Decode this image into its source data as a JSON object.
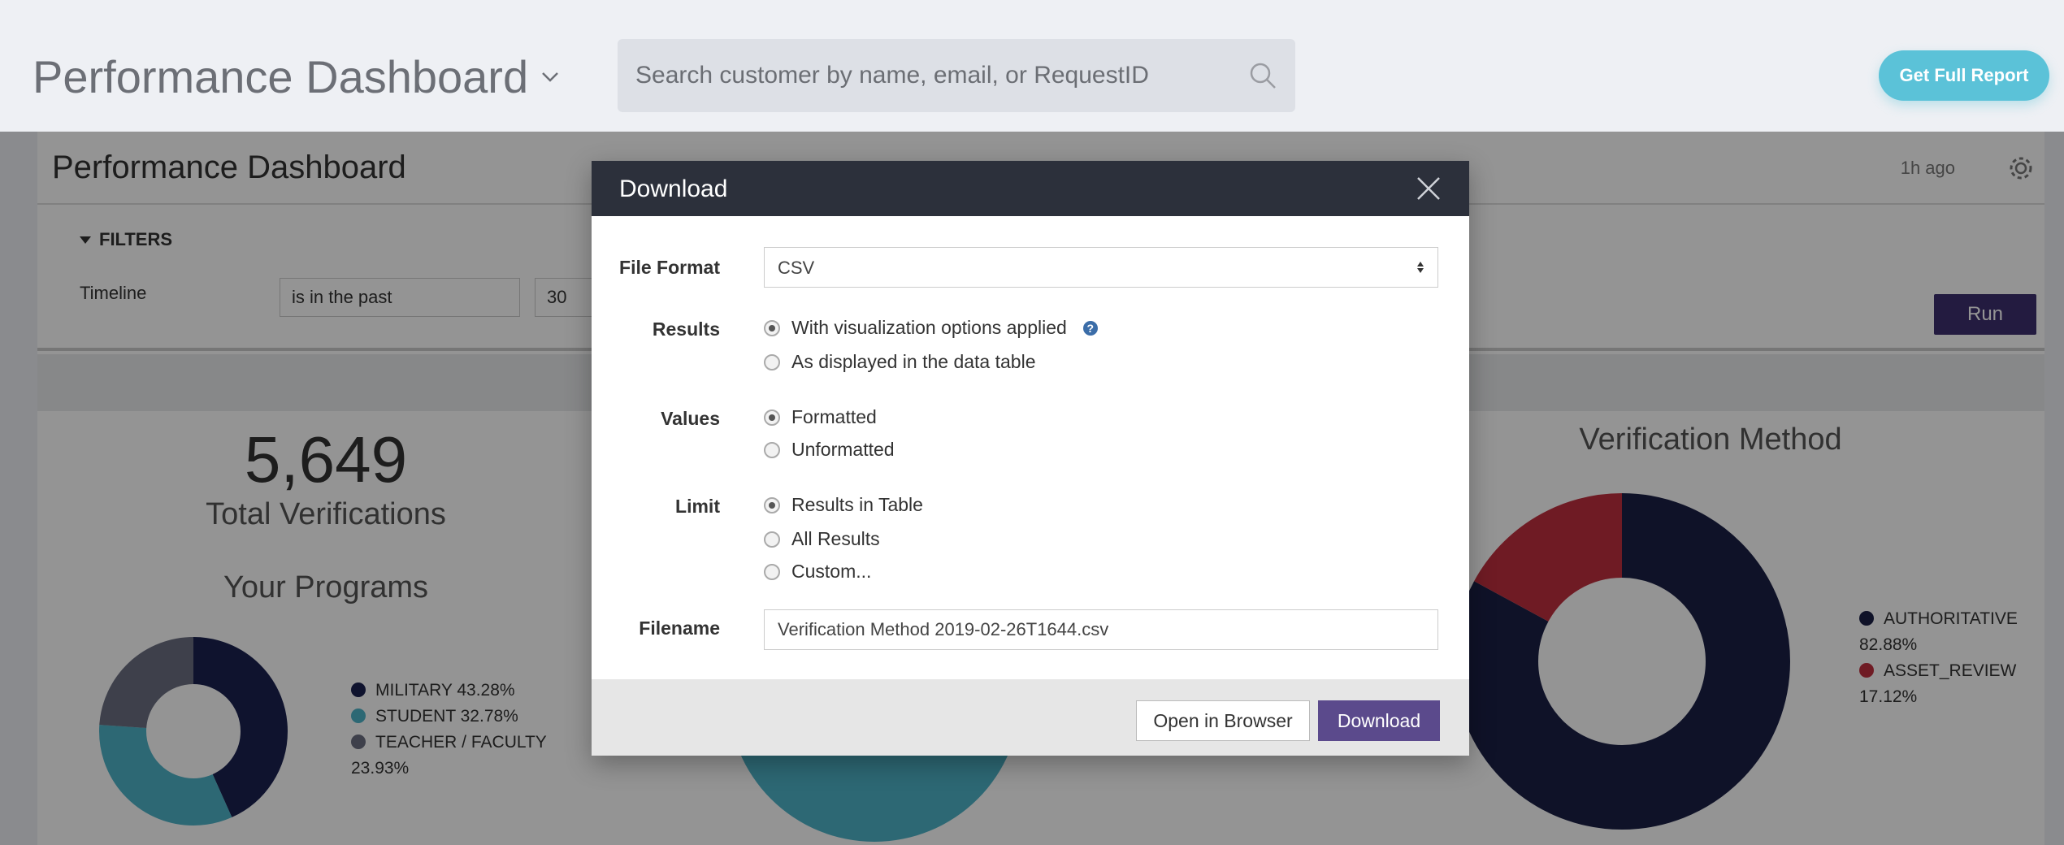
{
  "header": {
    "title": "Performance Dashboard",
    "search_placeholder": "Search customer by name, email, or RequestID",
    "get_report_label": "Get Full Report"
  },
  "dashboard": {
    "title": "Performance Dashboard",
    "updated": "1h ago",
    "filters_label": "FILTERS",
    "timeline_label": "Timeline",
    "timeline_operator": "is in the past",
    "timeline_value": "30",
    "run_label": "Run",
    "total": {
      "value": "5,649",
      "label": "Total Verifications"
    },
    "programs": {
      "title": "Your Programs",
      "legend": [
        {
          "label": "MILITARY 43.28%",
          "color": "#1a2150"
        },
        {
          "label": "STUDENT 32.78%",
          "color": "#4fb3c8"
        },
        {
          "label": "TEACHER / FACULTY",
          "extra": "23.93%",
          "color": "#6b6f82"
        }
      ]
    },
    "method": {
      "title": "Verification Method",
      "legend": [
        {
          "label": "AUTHORITATIVE",
          "value": "82.88%",
          "color": "#1a1f45"
        },
        {
          "label": "ASSET_REVIEW",
          "value": "17.12%",
          "color": "#c0303e"
        }
      ]
    }
  },
  "modal": {
    "title": "Download",
    "file_format_label": "File Format",
    "file_format_value": "CSV",
    "results_label": "Results",
    "results_options": [
      "With visualization options applied",
      "As displayed in the data table"
    ],
    "values_label": "Values",
    "values_options": [
      "Formatted",
      "Unformatted"
    ],
    "limit_label": "Limit",
    "limit_options": [
      "Results in Table",
      "All Results",
      "Custom..."
    ],
    "filename_label": "Filename",
    "filename_value": "Verification Method 2019-02-26T1644.csv",
    "open_label": "Open in Browser",
    "download_label": "Download",
    "help_glyph": "?"
  }
}
